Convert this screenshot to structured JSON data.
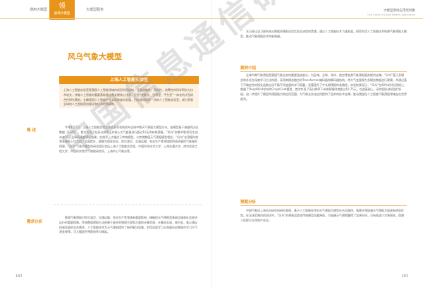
{
  "header": {
    "tab1": "通用大模型",
    "tab2_icon": "领",
    "tab2": "垂域大模型",
    "tab3": "大模型服务",
    "right_title": "大模型落地应用案例集",
    "right_subtitle": "Use Cases of Large Models Application"
  },
  "left": {
    "title": "风乌气象大模型",
    "lab_name": "上海人工智能实验室",
    "lab_desc": "上海人工智能实验室是我国人工智能领域的新型科研机构，开展战略性、原创性、前瞻性的科学研究与技术攻关，突破人工智能的重要基础理论和关键核心技术，打造“突破型、引领型、平台型”一体化的大型综合性研究基地，支撑我国人工智能产业实现跨越式发展，目标建成国际一流的人工智能实验室，成为享誉全球的人工智能原创理论和技术的策源地。",
    "section1": "概  述",
    "para1": "今年4月7日，上海人工智能实验室联合多家机构发布全球中期天气预报大模型风乌。该模型基于海量的历史数据（ERA5），首次实现了在高分辨率上对核心大气变量进行超过10天的有效预报。“风乌”仅需30秒即可生成未来10天全球高精度预报结果，在效率上大幅优于传统模型。与传统数值天气预报模型相比，“风乌”在预报时效和准确率上均实现了全面提升，能够为国家安全、防灾减灾、交通运输、农业生产等领域提供高质量的气象服务保障。“风乌”气象大模型的研发团队包括上海人工智能实验室、中国科学技术大学、上海交通大学、南京信息工程大学、中国科学院大气物理研究所、上海中心气象台等。",
    "section2": "需求分析",
    "para2": "数值气象预报对防灾减灾、交通运输、农业生产等领域有重要影响，精确的天气预报是基础设施和社会经济运行的重要保障。传统数值预报方法依赖于复杂的物理方程和大量的计算资源，计算成本高、耗时长，难以满足快速发展的业务需求。人工智能技术为天气预报提供了新的解决思路，利用深度学习从海量历史数据中学习大气演变规律，可大幅提升预报效率与精度。",
    "page_number": "182"
  },
  "right": {
    "para_top": "本已经让该卫星系统从数据到预报应用实现全流程的贯通，通过人工智能技术飞速发展，探索利用人工智能技术构建气象预报大模型，推动气象预报技术的新跨越。",
    "section1": "案例介绍",
    "para1": "全球中期气象预报是我国气象业务的重要组成部分，为区域、全球、海洋、航空等各类气象预报服务提供支撑。“风乌”基于多模态和多任务深度学习方法构建，采用跨模态融合的Transformer编码器和解码器结构，将大气变量视为多模态数据进行建模，并通过基于不确定性的损失函数自动平衡不同变量的学习权重，显著提升了中长期预报的准确性。实验结果显示，“风乌”在80%的评估指标上超越了DeepMind发布的GraphCast模型，首次实现了高分辨率下有效预报时效超过10.75天。在此基础上，研究团队持续迭代升级，进一步提升了模型的预报能力和应用范围，为气象业务化应用提供了坚实的技术支撑，推动我国在人工智能气象预报领域走在世界前列。",
    "section2": "预期分析",
    "para2": "中国气象局上海台风研究所研究表明，基于人工智能技术的天气预报大模型在台风路径、强降水等极端天气预报方面具有明显优势。在全球范围内的测试中，“风乌”的预报误差较传统模型显著降低，为极端天气预警赢得了宝贵时间，可有效减少灾害损失，保障人民群众生命财产安全。",
    "page_number": "183"
  },
  "watermark": "中国信息通信研究院"
}
